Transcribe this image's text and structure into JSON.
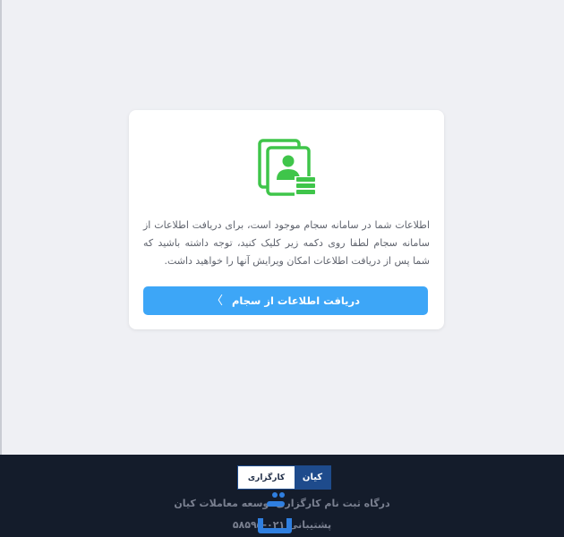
{
  "card": {
    "icon": "profile-document-icon",
    "description": "اطلاعات شما در سامانه سجام موجود است، برای دریافت اطلاعات از سامانه سجام لطفا روی دکمه زیر کلیک کنید، توجه داشته باشید که شما پس از دریافت اطلاعات امکان ویرایش آنها را خواهید داشت.",
    "button_label": "دریافت اطلاعات از سجام",
    "button_icon": "chevron-left-icon"
  },
  "footer": {
    "logo_blue_text": "کیان",
    "logo_white_text": "کارگزاری",
    "title": "درگاه ثبت نام کارگزاری توسعه معاملات کیان",
    "support": "پشتیبانی ۰۲۱-۵۸۵۹۵"
  },
  "colors": {
    "accent": "#3da6f7",
    "icon_green": "#3fc54a",
    "footer_bg": "#141c2b",
    "brand_blue": "#1e4b8c"
  }
}
